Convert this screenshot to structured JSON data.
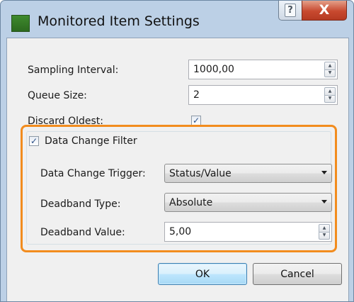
{
  "window": {
    "title": "Monitored Item Settings",
    "help_glyph": "?",
    "close_glyph": "X",
    "app_icon": "green-square-icon",
    "accent_color": "#f28c1e"
  },
  "form": {
    "sampling_interval": {
      "label": "Sampling Interval:",
      "value": "1000,00"
    },
    "queue_size": {
      "label": "Queue Size:",
      "value": "2"
    },
    "discard_oldest": {
      "label": "Discard Oldest:",
      "checked": true
    },
    "data_change_filter": {
      "label": "Data Change Filter",
      "checked": true,
      "trigger": {
        "label": "Data Change Trigger:",
        "value": "Status/Value"
      },
      "deadband_type": {
        "label": "Deadband Type:",
        "value": "Absolute"
      },
      "deadband_value": {
        "label": "Deadband Value:",
        "value": "5,00"
      }
    }
  },
  "buttons": {
    "ok": "OK",
    "cancel": "Cancel"
  },
  "glyphs": {
    "check": "✓",
    "spin_up": "▲",
    "spin_down": "▼"
  }
}
